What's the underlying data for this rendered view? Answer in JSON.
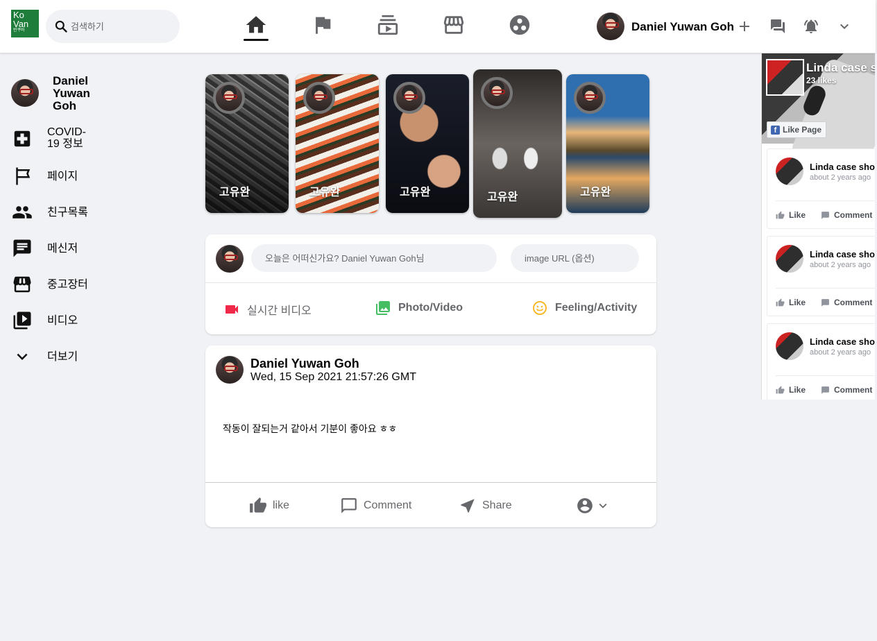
{
  "header": {
    "logo": {
      "line1": "Ko",
      "line2": "Van",
      "line3": "빈쿠바"
    },
    "search": {
      "placeholder": "검색하기"
    },
    "nav": [
      "home-icon",
      "flag-icon",
      "video-icon",
      "marketplace-icon",
      "groups-icon"
    ],
    "user_name": "Daniel Yuwan Goh"
  },
  "sidebar": {
    "profile_name": "Daniel Yuwan Goh",
    "items": [
      {
        "label": "COVID-19 정보",
        "icon": "medical-cross-icon"
      },
      {
        "label": "페이지",
        "icon": "tour-flag-icon"
      },
      {
        "label": "친구목록",
        "icon": "people-icon"
      },
      {
        "label": "메신저",
        "icon": "chat-icon"
      },
      {
        "label": "중고장터",
        "icon": "storefront-icon"
      },
      {
        "label": "비디오",
        "icon": "video-library-icon"
      },
      {
        "label": "더보기",
        "icon": "chevron-down-icon"
      }
    ]
  },
  "stories": [
    {
      "name": "고유완",
      "theme": "gym"
    },
    {
      "name": "고유완",
      "theme": "sushi"
    },
    {
      "name": "고유완",
      "theme": "party"
    },
    {
      "name": "고유완",
      "theme": "street"
    },
    {
      "name": "고유완",
      "theme": "city"
    }
  ],
  "create_post": {
    "message_placeholder": "오늘은 어떠신가요? Daniel Yuwan Goh님",
    "image_placeholder": "image URL (옵션)",
    "actions": {
      "live": "실시간 비디오",
      "photo": "Photo/Video",
      "feeling": "Feeling/Activity"
    }
  },
  "post": {
    "author": "Daniel Yuwan Goh",
    "timestamp": "Wed, 15 Sep 2021 21:57:26 GMT",
    "text": "작동이 잘되는거 같아서 기분이 좋아요 ㅎㅎ",
    "actions": {
      "like": "like",
      "comment": "Comment",
      "share": "Share"
    }
  },
  "fb_widget": {
    "page_title": "Linda case s",
    "likes": "23 likes",
    "like_button": "Like Page",
    "posts": [
      {
        "name": "Linda case sho",
        "time": "about 2 years ago",
        "like": "Like",
        "comment": "Comment"
      },
      {
        "name": "Linda case sho",
        "time": "about 2 years ago",
        "like": "Like",
        "comment": "Comment"
      },
      {
        "name": "Linda case sho",
        "time": "about 2 years ago",
        "like": "Like",
        "comment": "Comment"
      }
    ]
  },
  "colors": {
    "live_icon": "#f02849",
    "photo_icon": "#45bd62",
    "feeling_icon": "#f7b928",
    "facebook_blue": "#4267b2"
  }
}
